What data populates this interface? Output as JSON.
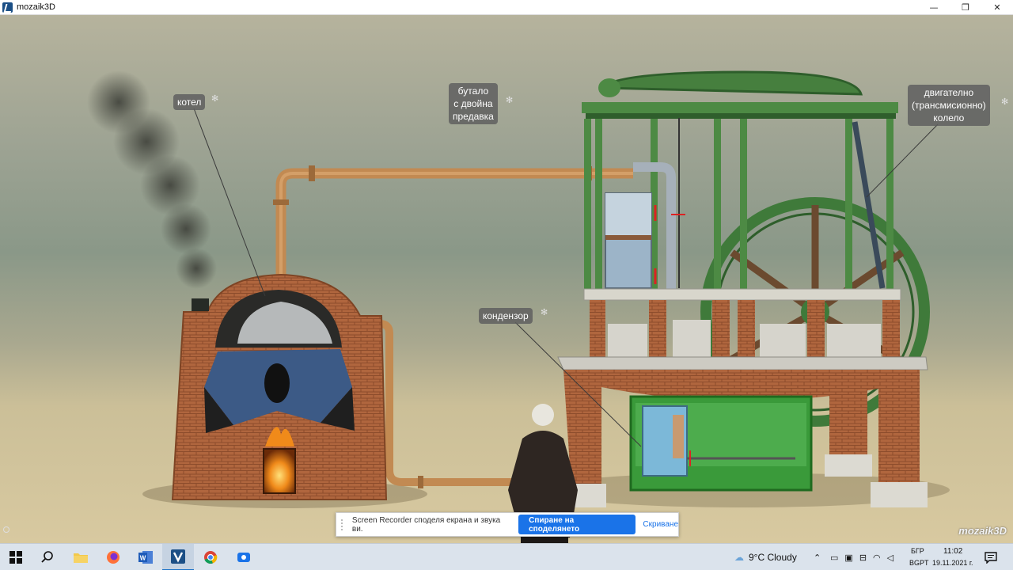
{
  "window": {
    "title": "mozaik3D",
    "minimize_glyph": "—",
    "restore_glyph": "❐",
    "close_glyph": "✕"
  },
  "scene": {
    "labels": {
      "boiler": "котел",
      "piston": [
        "бутало",
        "с двойна",
        "предавка"
      ],
      "wheel": [
        "двигателно",
        "(трансмисионно)",
        "колело"
      ],
      "condenser": "кондензор"
    },
    "brand": "mozaik3D"
  },
  "sharebar": {
    "message": "Screen Recorder споделя екрана и звука ви.",
    "stop_label": "Спиране на споделянето",
    "hide_label": "Скриване"
  },
  "taskbar": {
    "apps": [
      "windows-start",
      "search",
      "file-explorer",
      "firefox",
      "word",
      "mozaik3d",
      "chrome",
      "screen-recorder"
    ],
    "weather": "9°C  Cloudy",
    "lang_top": "БГР",
    "lang_bottom": "BGPT",
    "time": "11:02",
    "date": "19.11.2021 г.",
    "colors": {
      "accent": "#1a73e8",
      "taskbar": "#dbe3ec"
    }
  }
}
